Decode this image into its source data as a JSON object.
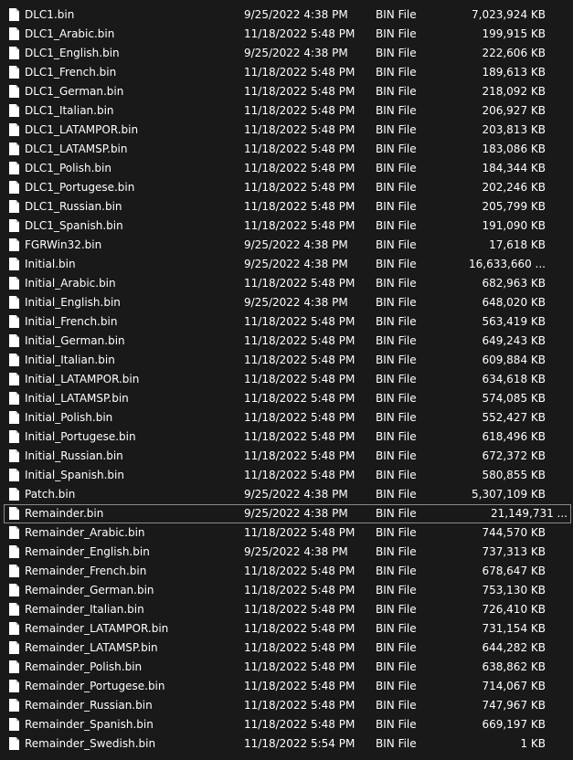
{
  "icons": {
    "file": "file-icon"
  },
  "files": [
    {
      "name": "DLC1.bin",
      "date": "9/25/2022 4:38 PM",
      "type": "BIN File",
      "size": "7,023,924 KB"
    },
    {
      "name": "DLC1_Arabic.bin",
      "date": "11/18/2022 5:48 PM",
      "type": "BIN File",
      "size": "199,915 KB"
    },
    {
      "name": "DLC1_English.bin",
      "date": "9/25/2022 4:38 PM",
      "type": "BIN File",
      "size": "222,606 KB"
    },
    {
      "name": "DLC1_French.bin",
      "date": "11/18/2022 5:48 PM",
      "type": "BIN File",
      "size": "189,613 KB"
    },
    {
      "name": "DLC1_German.bin",
      "date": "11/18/2022 5:48 PM",
      "type": "BIN File",
      "size": "218,092 KB"
    },
    {
      "name": "DLC1_Italian.bin",
      "date": "11/18/2022 5:48 PM",
      "type": "BIN File",
      "size": "206,927 KB"
    },
    {
      "name": "DLC1_LATAMPOR.bin",
      "date": "11/18/2022 5:48 PM",
      "type": "BIN File",
      "size": "203,813 KB"
    },
    {
      "name": "DLC1_LATAMSP.bin",
      "date": "11/18/2022 5:48 PM",
      "type": "BIN File",
      "size": "183,086 KB"
    },
    {
      "name": "DLC1_Polish.bin",
      "date": "11/18/2022 5:48 PM",
      "type": "BIN File",
      "size": "184,344 KB"
    },
    {
      "name": "DLC1_Portugese.bin",
      "date": "11/18/2022 5:48 PM",
      "type": "BIN File",
      "size": "202,246 KB"
    },
    {
      "name": "DLC1_Russian.bin",
      "date": "11/18/2022 5:48 PM",
      "type": "BIN File",
      "size": "205,799 KB"
    },
    {
      "name": "DLC1_Spanish.bin",
      "date": "11/18/2022 5:48 PM",
      "type": "BIN File",
      "size": "191,090 KB"
    },
    {
      "name": "FGRWin32.bin",
      "date": "9/25/2022 4:38 PM",
      "type": "BIN File",
      "size": "17,618 KB"
    },
    {
      "name": "Initial.bin",
      "date": "9/25/2022 4:38 PM",
      "type": "BIN File",
      "size": "16,633,660 ..."
    },
    {
      "name": "Initial_Arabic.bin",
      "date": "11/18/2022 5:48 PM",
      "type": "BIN File",
      "size": "682,963 KB"
    },
    {
      "name": "Initial_English.bin",
      "date": "9/25/2022 4:38 PM",
      "type": "BIN File",
      "size": "648,020 KB"
    },
    {
      "name": "Initial_French.bin",
      "date": "11/18/2022 5:48 PM",
      "type": "BIN File",
      "size": "563,419 KB"
    },
    {
      "name": "Initial_German.bin",
      "date": "11/18/2022 5:48 PM",
      "type": "BIN File",
      "size": "649,243 KB"
    },
    {
      "name": "Initial_Italian.bin",
      "date": "11/18/2022 5:48 PM",
      "type": "BIN File",
      "size": "609,884 KB"
    },
    {
      "name": "Initial_LATAMPOR.bin",
      "date": "11/18/2022 5:48 PM",
      "type": "BIN File",
      "size": "634,618 KB"
    },
    {
      "name": "Initial_LATAMSP.bin",
      "date": "11/18/2022 5:48 PM",
      "type": "BIN File",
      "size": "574,085 KB"
    },
    {
      "name": "Initial_Polish.bin",
      "date": "11/18/2022 5:48 PM",
      "type": "BIN File",
      "size": "552,427 KB"
    },
    {
      "name": "Initial_Portugese.bin",
      "date": "11/18/2022 5:48 PM",
      "type": "BIN File",
      "size": "618,496 KB"
    },
    {
      "name": "Initial_Russian.bin",
      "date": "11/18/2022 5:48 PM",
      "type": "BIN File",
      "size": "672,372 KB"
    },
    {
      "name": "Initial_Spanish.bin",
      "date": "11/18/2022 5:48 PM",
      "type": "BIN File",
      "size": "580,855 KB"
    },
    {
      "name": "Patch.bin",
      "date": "9/25/2022 4:38 PM",
      "type": "BIN File",
      "size": "5,307,109 KB"
    },
    {
      "name": "Remainder.bin",
      "date": "9/25/2022 4:38 PM",
      "type": "BIN File",
      "size": "21,149,731 ...",
      "focused": true
    },
    {
      "name": "Remainder_Arabic.bin",
      "date": "11/18/2022 5:48 PM",
      "type": "BIN File",
      "size": "744,570 KB"
    },
    {
      "name": "Remainder_English.bin",
      "date": "9/25/2022 4:38 PM",
      "type": "BIN File",
      "size": "737,313 KB"
    },
    {
      "name": "Remainder_French.bin",
      "date": "11/18/2022 5:48 PM",
      "type": "BIN File",
      "size": "678,647 KB"
    },
    {
      "name": "Remainder_German.bin",
      "date": "11/18/2022 5:48 PM",
      "type": "BIN File",
      "size": "753,130 KB"
    },
    {
      "name": "Remainder_Italian.bin",
      "date": "11/18/2022 5:48 PM",
      "type": "BIN File",
      "size": "726,410 KB"
    },
    {
      "name": "Remainder_LATAMPOR.bin",
      "date": "11/18/2022 5:48 PM",
      "type": "BIN File",
      "size": "731,154 KB"
    },
    {
      "name": "Remainder_LATAMSP.bin",
      "date": "11/18/2022 5:48 PM",
      "type": "BIN File",
      "size": "644,282 KB"
    },
    {
      "name": "Remainder_Polish.bin",
      "date": "11/18/2022 5:48 PM",
      "type": "BIN File",
      "size": "638,862 KB"
    },
    {
      "name": "Remainder_Portugese.bin",
      "date": "11/18/2022 5:48 PM",
      "type": "BIN File",
      "size": "714,067 KB"
    },
    {
      "name": "Remainder_Russian.bin",
      "date": "11/18/2022 5:48 PM",
      "type": "BIN File",
      "size": "747,967 KB"
    },
    {
      "name": "Remainder_Spanish.bin",
      "date": "11/18/2022 5:48 PM",
      "type": "BIN File",
      "size": "669,197 KB"
    },
    {
      "name": "Remainder_Swedish.bin",
      "date": "11/18/2022 5:54 PM",
      "type": "BIN File",
      "size": "1 KB"
    }
  ]
}
